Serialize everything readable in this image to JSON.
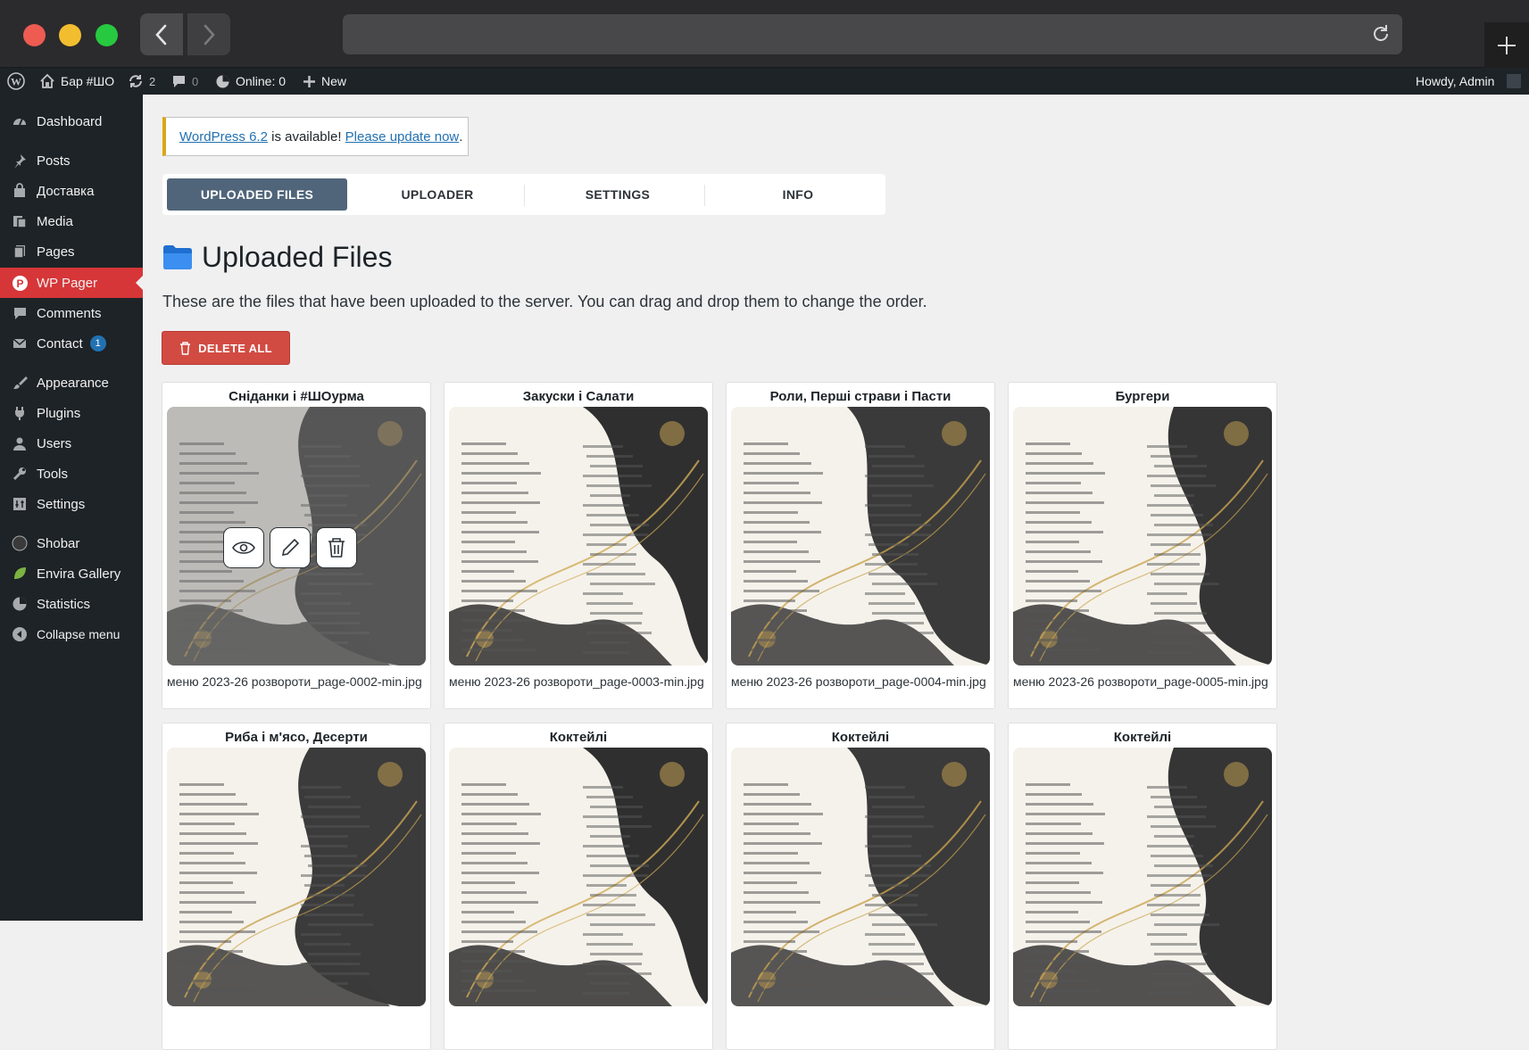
{
  "adminbar": {
    "site_name": "Бар #ШО",
    "updates_count": "2",
    "comments_count": "0",
    "online_label": "Online: 0",
    "new_label": "New",
    "howdy": "Howdy, Admin"
  },
  "sidebar": {
    "items": [
      {
        "label": "Dashboard",
        "icon": "dashboard-icon"
      },
      {
        "label": "Posts",
        "icon": "pin-icon"
      },
      {
        "label": "Доставка",
        "icon": "bag-icon"
      },
      {
        "label": "Media",
        "icon": "media-icon"
      },
      {
        "label": "Pages",
        "icon": "pages-icon"
      },
      {
        "label": "WP Pager",
        "icon": "wp-pager-icon"
      },
      {
        "label": "Comments",
        "icon": "comment-icon"
      },
      {
        "label": "Contact",
        "icon": "mail-icon",
        "badge": "1"
      },
      {
        "label": "Appearance",
        "icon": "brush-icon"
      },
      {
        "label": "Plugins",
        "icon": "plugin-icon"
      },
      {
        "label": "Users",
        "icon": "user-icon"
      },
      {
        "label": "Tools",
        "icon": "wrench-icon"
      },
      {
        "label": "Settings",
        "icon": "settings-icon"
      },
      {
        "label": "Shobar",
        "icon": "shobar-icon"
      },
      {
        "label": "Envira Gallery",
        "icon": "leaf-icon"
      },
      {
        "label": "Statistics",
        "icon": "pie-icon"
      },
      {
        "label": "Collapse menu",
        "icon": "collapse-icon"
      }
    ]
  },
  "notice": {
    "link1": "WordPress 6.2",
    "text": " is available! ",
    "link2": "Please update now",
    "end": "."
  },
  "tabs": [
    "UPLOADED FILES",
    "UPLOADER",
    "SETTINGS",
    "INFO"
  ],
  "page": {
    "title": "Uploaded Files",
    "description": "These are the files that have been uploaded to the server. You can drag and drop them to change the order.",
    "delete_all": "DELETE ALL"
  },
  "files": [
    {
      "title": "Сніданки і #ШОурма",
      "filename": "меню 2023-26 розвороти_page-0002-min.jpg"
    },
    {
      "title": "Закуски і Салати",
      "filename": "меню 2023-26 розвороти_page-0003-min.jpg"
    },
    {
      "title": "Роли, Перші страви і Пасти",
      "filename": "меню 2023-26 розвороти_page-0004-min.jpg"
    },
    {
      "title": "Бургери",
      "filename": "меню 2023-26 розвороти_page-0005-min.jpg"
    },
    {
      "title": "Риба і м'ясо, Десерти",
      "filename": ""
    },
    {
      "title": "Коктейлі",
      "filename": ""
    },
    {
      "title": "Коктейлі",
      "filename": ""
    },
    {
      "title": "Коктейлі",
      "filename": ""
    }
  ],
  "colors": {
    "accent": "#d63638",
    "tab_active": "#50657a",
    "delete": "#d24b42",
    "link": "#2271b1"
  }
}
